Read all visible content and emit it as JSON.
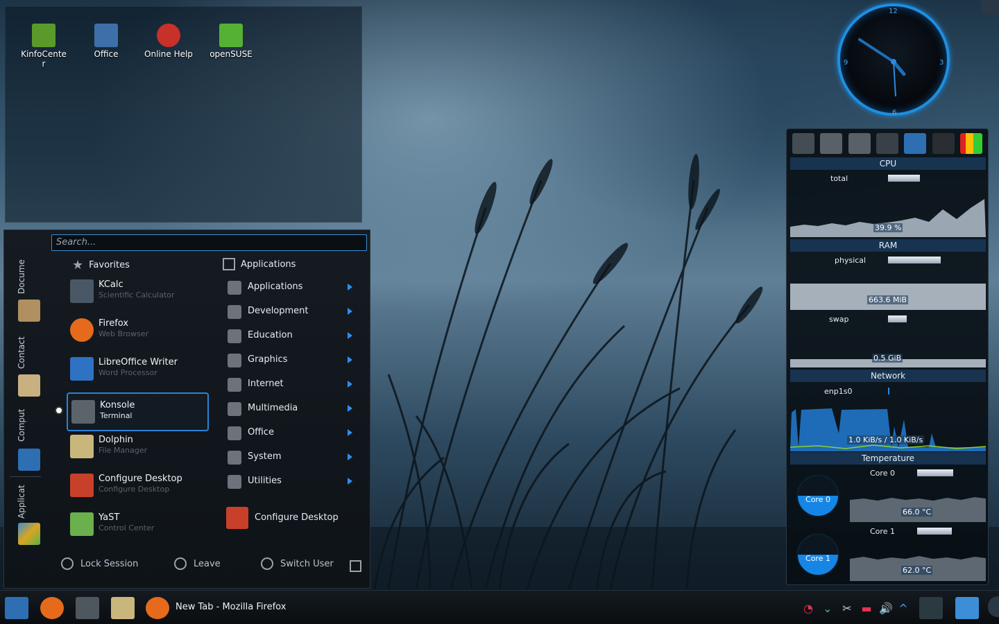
{
  "desktop": {
    "icons": [
      {
        "label": "KinfoCenter",
        "icon": "kinfocenter-icon",
        "color": "#5a9a2a"
      },
      {
        "label": "Office",
        "icon": "office-icon",
        "color": "#3f6fa8"
      },
      {
        "label": "Online Help",
        "icon": "help-icon",
        "color": "#c8302a"
      },
      {
        "label": "openSUSE",
        "icon": "opensuse-icon",
        "color": "#55b134"
      }
    ]
  },
  "clock": {
    "numbers": [
      "12",
      "3",
      "6",
      "9"
    ]
  },
  "sysmon": {
    "cpu": {
      "header": "CPU",
      "label": "total",
      "graph_value": "39.9 %",
      "level": 0.399
    },
    "ram": {
      "header": "RAM",
      "physical_label": "physical",
      "physical_value": "663.6 MiB",
      "swap_label": "swap",
      "swap_value": "0.5 GiB"
    },
    "network": {
      "header": "Network",
      "iface": "enp1s0",
      "value": "1.0 KiB/s / 1.0 KiB/s"
    },
    "temperature": {
      "header": "Temperature",
      "cores": [
        {
          "label": "Core 0",
          "gauge_label": "Core 0",
          "value": "66.0 °C"
        },
        {
          "label": "Core 1",
          "gauge_label": "Core 1",
          "value": "62.0 °C"
        }
      ]
    }
  },
  "launcher": {
    "search_placeholder": "Search...",
    "side_tabs": [
      "Docume",
      "Contact",
      "Comput",
      "Applicat"
    ],
    "favorites_header": "Favorites",
    "favorites": [
      {
        "name": "KCalc",
        "desc": "Scientific Calculator",
        "icon": "kcalc-icon",
        "color": "#4a5866"
      },
      {
        "name": "Firefox",
        "desc": "Web Browser",
        "icon": "firefox-icon",
        "color": "#e66a1c"
      },
      {
        "name": "LibreOffice Writer",
        "desc": "Word Processor",
        "icon": "writer-icon",
        "color": "#2f72c4"
      },
      {
        "name": "Konsole",
        "desc": "Terminal",
        "icon": "konsole-icon",
        "color": "#5b636b"
      },
      {
        "name": "Dolphin",
        "desc": "File Manager",
        "icon": "dolphin-icon",
        "color": "#c9b67a"
      },
      {
        "name": "Configure Desktop",
        "desc": "Configure Desktop",
        "icon": "configure-icon",
        "color": "#c8402a"
      },
      {
        "name": "YaST",
        "desc": "Control Center",
        "icon": "yast-icon",
        "color": "#6ab04c"
      }
    ],
    "applications_header": "Applications",
    "categories": [
      "Applications",
      "Development",
      "Education",
      "Graphics",
      "Internet",
      "Multimedia",
      "Office",
      "System",
      "Utilities"
    ],
    "configure_desktop": "Configure Desktop",
    "bottom": {
      "lock": "Lock Session",
      "leave": "Leave",
      "switch": "Switch User"
    }
  },
  "taskbar": {
    "window_title": "New Tab - Mozilla Firefox"
  }
}
